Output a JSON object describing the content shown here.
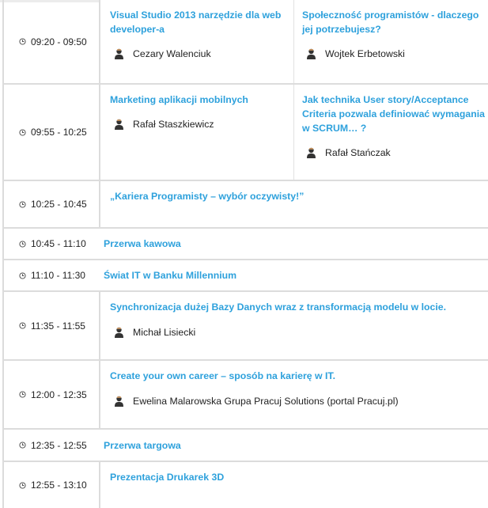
{
  "schedule": [
    {
      "time": "09:20 - 09:50",
      "sessions": [
        {
          "title": "Visual Studio 2013 narzędzie dla web developer-a",
          "speaker": "Cezary Walenciuk"
        },
        {
          "title": "Społeczność programistów - dlaczego jej potrzebujesz?",
          "speaker": "Wojtek Erbetowski"
        }
      ]
    },
    {
      "time": "09:55 - 10:25",
      "sessions": [
        {
          "title": "Marketing aplikacji mobilnych",
          "speaker": "Rafał Staszkiewicz"
        },
        {
          "title": "Jak technika User story/Acceptance Criteria pozwala definiować wymagania w SCRUM… ?",
          "speaker": "Rafał Stańczak"
        }
      ]
    },
    {
      "time": "10:25 - 10:45",
      "sessions": [
        {
          "title": "„Kariera Programisty – wybór oczywisty!”"
        }
      ]
    },
    {
      "time": "10:45 - 11:10",
      "break": "Przerwa kawowa"
    },
    {
      "time": "11:10 - 11:30",
      "break": "Świat IT w Banku Millennium"
    },
    {
      "time": "11:35 - 11:55",
      "sessions": [
        {
          "title": "Synchronizacja dużej Bazy Danych wraz z transformacją modelu w locie.",
          "speaker": "Michał Lisiecki"
        }
      ]
    },
    {
      "time": "12:00 - 12:35",
      "sessions": [
        {
          "title": "Create your own career – sposób na karierę w IT.",
          "speaker": "Ewelina Malarowska Grupa Pracuj Solutions (portal Pracuj.pl)"
        }
      ]
    },
    {
      "time": "12:35 - 12:55",
      "break": "Przerwa targowa"
    },
    {
      "time": "12:55 - 13:10",
      "sessions": [
        {
          "title": "Prezentacja Drukarek 3D"
        }
      ]
    }
  ],
  "icons": {
    "time": "clock-icon",
    "speaker": "person-icon"
  },
  "colors": {
    "link": "#2ea1dc",
    "border": "#dcdcdc"
  }
}
